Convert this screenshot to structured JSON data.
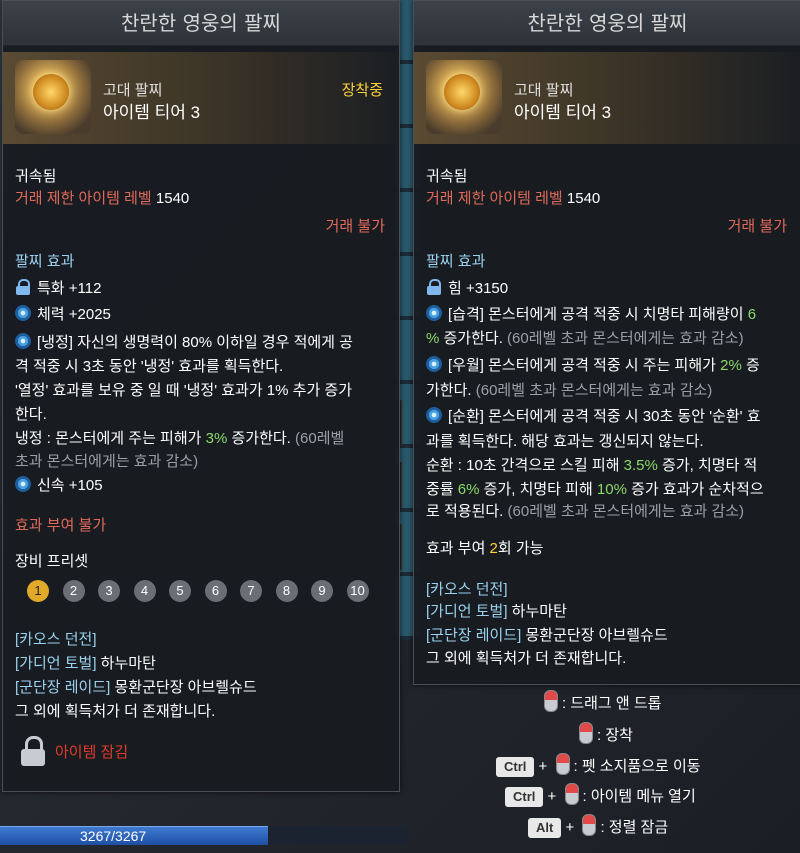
{
  "left_tooltip": {
    "title": "찬란한 영웅의 팔찌",
    "category": "고대 팔찌",
    "tier": "아이템 티어 3",
    "equipped": "장착중",
    "bound": "귀속됨",
    "trade_level_label": "거래 제한 아이템 레벨",
    "trade_level_value": "1540",
    "trade_status": "거래 불가",
    "effects_header": "팔찌 효과",
    "stat1": "특화 +112",
    "stat2": "체력 +2025",
    "effect_a_l1": "[냉정] 자신의 생명력이 80% 이하일 경우 적에게 공",
    "effect_a_l2": "격 적중 시 3초 동안 '냉정' 효과를 획득한다.",
    "effect_a_l3": "'열정' 효과를 보유 중 일 때 '냉정' 효과가 1% 추가 증가",
    "effect_a_l4": "한다.",
    "effect_a_l5_pre": "냉정 : 몬스터에게 주는 피해가 ",
    "effect_a_l5_val": "3%",
    "effect_a_l5_post": " 증가한다.",
    "effect_a_l5_gray": " (60레벨",
    "effect_a_l6": "초과 몬스터에게는 효과 감소)",
    "stat3": "신속 +105",
    "grant": "효과 부여 불가",
    "preset_header": "장비 프리셋",
    "presets": [
      "1",
      "2",
      "3",
      "4",
      "5",
      "6",
      "7",
      "8",
      "9",
      "10"
    ],
    "src1": "[카오스 던전]",
    "src2_tag": "[가디언 토벌]",
    "src2_name": " 하누마탄",
    "src3_tag": "[군단장 레이드]",
    "src3_name": " 몽환군단장 아브렐슈드",
    "src_more": "그 외에 획득처가 더 존재합니다.",
    "lock_text": "아이템 잠김"
  },
  "right_tooltip": {
    "title": "찬란한 영웅의 팔찌",
    "category": "고대 팔찌",
    "tier": "아이템 티어 3",
    "bound": "귀속됨",
    "trade_level_label": "거래 제한 아이템 레벨",
    "trade_level_value": "1540",
    "trade_status": "거래 불가",
    "effects_header": "팔찌 효과",
    "stat1": "힘 +3150",
    "e1_l1_pre": "[습격] 몬스터에게 공격 적중 시 치명타 피해량이 ",
    "e1_l1_val": "6",
    "e1_l2_val": "%",
    "e1_l2_post": " 증가한다.",
    "e1_l2_gray": " (60레벨 초과 몬스터에게는 효과 감소)",
    "e2_l1_pre": "[우월] 몬스터에게 공격 적중 시 주는 피해가 ",
    "e2_l1_val": "2%",
    "e2_l1_post": " 증",
    "e2_l2": "가한다.",
    "e2_l2_gray": " (60레벨 초과 몬스터에게는 효과 감소)",
    "e3_l1": "[순환] 몬스터에게 공격 적중 시 30초 동안 '순환' 효",
    "e3_l2": "과를 획득한다. 해당 효과는 갱신되지 않는다.",
    "e3_l3_pre": "순환 : 10초 간격으로 스킬 피해 ",
    "e3_l3_val": "3.5%",
    "e3_l3_post": " 증가, 치명타 적",
    "e3_l4_pre": "중률 ",
    "e3_l4_val1": "6%",
    "e3_l4_mid": " 증가, 치명타 피해 ",
    "e3_l4_val2": "10%",
    "e3_l4_post": " 증가 효과가 순차적으",
    "e3_l5": "로 적용된다.",
    "e3_l5_gray": " (60레벨 초과 몬스터에게는 효과 감소)",
    "grant_pre": "효과 부여 ",
    "grant_val": "2",
    "grant_post": "회 가능",
    "src1": "[카오스 던전]",
    "src2_tag": "[가디언 토벌]",
    "src2_name": " 하누마탄",
    "src3_tag": "[군단장 레이드]",
    "src3_name": " 몽환군단장 아브렐슈드",
    "src_more": "그 외에 획득처가 더 존재합니다."
  },
  "hints": {
    "drag": ": 드래그 앤 드롭",
    "equip": ": 장착",
    "pet_key": "Ctrl",
    "pet": ": 펫 소지품으로 이동",
    "menu_key": "Ctrl",
    "menu": ": 아이템 메뉴 열기",
    "lock_key": "Alt",
    "lock": ": 정렬 잠금"
  },
  "hp": "3267/3267"
}
